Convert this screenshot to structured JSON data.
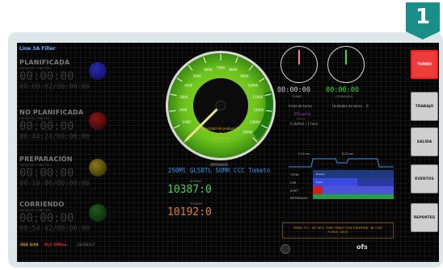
{
  "badge": {
    "number": "1"
  },
  "line_name": "Line 3A Filler",
  "states": [
    {
      "title": "PLANIFICADA",
      "sub": "DURACIÓN / OBJETIVO",
      "time": "00:00:00",
      "dur": "00:00:02/00:00:00",
      "color": "#1a1a8a"
    },
    {
      "title": "NO PLANIFICADA",
      "sub": "DURACIÓN / OBJETIVO",
      "time": "00:00:00",
      "dur": "00:44:24/00:00:00",
      "color": "#6a0f0f"
    },
    {
      "title": "PREPARACIÓN",
      "sub": "DURACIÓN / OBJETIVO",
      "time": "00:00:00",
      "dur": "00:10:00/00:00:00",
      "color": "#6a5a10"
    },
    {
      "title": "CORRIENDO",
      "sub": "DURACIÓN / OBJETIVO",
      "time": "00:00:00",
      "dur": "00:54:42/00:00:00",
      "color": "#1a4a1a"
    }
  ],
  "footer": {
    "left": "OEE 0/00",
    "mid": "PLC Offline",
    "right": "19/20/17"
  },
  "gauge": {
    "labels": [
      "1000",
      "2000",
      "3000",
      "4000",
      "5000",
      "6000",
      "7000",
      "8000",
      "9000",
      "10000",
      "11000",
      "12000",
      "13000",
      "14000"
    ],
    "center_top": "Velocidad de producción",
    "center_unit": "cajas / hora",
    "center_value": "0"
  },
  "operator_label": "OPERADOR",
  "product": "250Ml GLSBTL SUMR CCC Tomato",
  "counts": {
    "good_label": "BUENAS",
    "good": "10387",
    "good_suffix": "0",
    "total_label": "TOTALES",
    "total": "10192",
    "total_suffix": "0"
  },
  "clocks": {
    "left_time": "00:00:00",
    "left_cap": "TURNO",
    "right_time": "00:00:00",
    "right_cap": "CORRIENDO"
  },
  "shift_info": {
    "start_label": "Inicio de turno",
    "units_label": "Unidades de turno",
    "units_value": "0",
    "status": "ETA aerrar",
    "eta": "--:--:--",
    "rate": "0 cb/min / 1 hour"
  },
  "timeline": {
    "label1": "0.00 am",
    "label2": "6.00 am",
    "rows": [
      "TOTAL",
      "CUR",
      "SHIFT",
      "INTERVALOS"
    ],
    "legend": "Breaks",
    "legend2": "Night"
  },
  "message": "ERROR PLC: NO DATA FROM PRODUCTION EQUIPMENT ON LINE",
  "message2": "PLEASE CHECK",
  "brand": "ofs",
  "side_buttons": [
    {
      "label": "TURNO",
      "active": true
    },
    {
      "label": "TRABAJO",
      "active": false
    },
    {
      "label": "SALIDA",
      "active": false
    },
    {
      "label": "EVENTOS",
      "active": false
    },
    {
      "label": "REPORTES",
      "active": false
    }
  ]
}
